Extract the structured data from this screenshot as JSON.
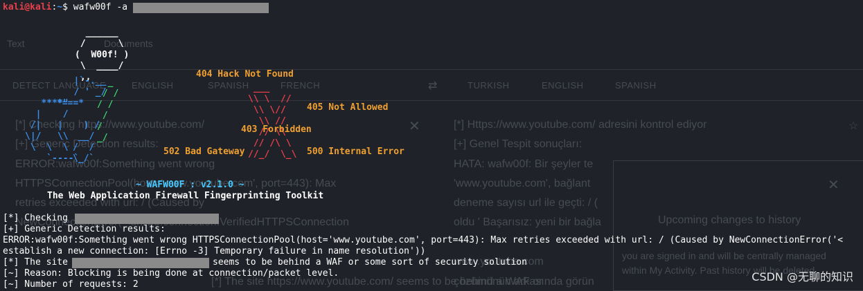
{
  "prompt": {
    "user": "kali@kali",
    "sep": ":",
    "path": "~",
    "symbol": "$",
    "command": "wafw00f -a"
  },
  "logo": {
    "bubble": [
      "  ______",
      " /      \\",
      "(  W00f! )",
      " \\  ____/",
      " ,,"
    ],
    "wall_labels": {
      "l404": "404 Hack Not Found",
      "l405": "405 Not Allowed",
      "l403": "403 Forbidden",
      "l502": "502 Bad Gateway",
      "l500": "500 Internal Error"
    },
    "version": "~ WAFW00F : v2.1.0 ~",
    "tagline": "The Web Application Firewall Fingerprinting Toolkit"
  },
  "output": {
    "l1_prefix": "[*] Checking",
    "l2": "[+] Generic Detection results:",
    "l3": "ERROR:wafw00f:Something went wrong HTTPSConnectionPool(host='www.youtube.com', port=443): Max retries exceeded with url: / (Caused by NewConnectionError('<",
    "l4": "establish a new connection: [Errno -3] Temporary failure in name resolution'))",
    "l5_prefix": "[*] The site",
    "l5_suffix": "seems to be behind a WAF or some sort of security solution",
    "l6": "[~] Reason: Blocking is being done at connection/packet level.",
    "l7": "[~] Number of requests: 2"
  },
  "background": {
    "tab_text": "Text",
    "tab_docs": "Documents",
    "src_langs": [
      "DETECT LANGUAGE",
      "ENGLISH",
      "SPANISH",
      "FRENCH"
    ],
    "dst_langs": [
      "TURKISH",
      "ENGLISH",
      "SPANISH"
    ],
    "src_lines": [
      "[*] Checking https://www.youtube.com/",
      "[+] Generic Detection results:",
      "ERROR:wafw00f:Something went wrong",
      "HTTPSConnectionPool(host='www.youtube.com', port=443): Max",
      "retries exceeded with url: / (Caused by",
      "NewConnectionError('<urllib3.connection.VerifiedHTTPSConnection"
    ],
    "dst_lines": [
      "[*] Https://www.youtube.com/ adresini kontrol ediyor",
      "[+] Genel Tespit sonuçları:",
      "HATA: wafw00f: Bir şeyler te",
      "'www.youtube.com', bağlant",
      "deneme sayısı url ile geçti: / (",
      "oldu ' Başarısız: yeni bir bağla",
      "www.youtube.com",
      "çözümünün arkasında görün"
    ],
    "history_title": "Upcoming changes to history",
    "history_l1": "you are signed in and will be centrally managed",
    "history_l2": "within My Activity. Past history will be deleted",
    "src_tail": "[*] The site https://www.youtube.com/ seems to be behind a WAF or"
  },
  "watermark": "CSDN @无聊的知识",
  "colors": {
    "bg": "#1f2228",
    "red": "#e8404a",
    "blue": "#3b8eea",
    "orange": "#f0a030",
    "green": "#3ed06d",
    "cyan": "#47c8ff"
  }
}
